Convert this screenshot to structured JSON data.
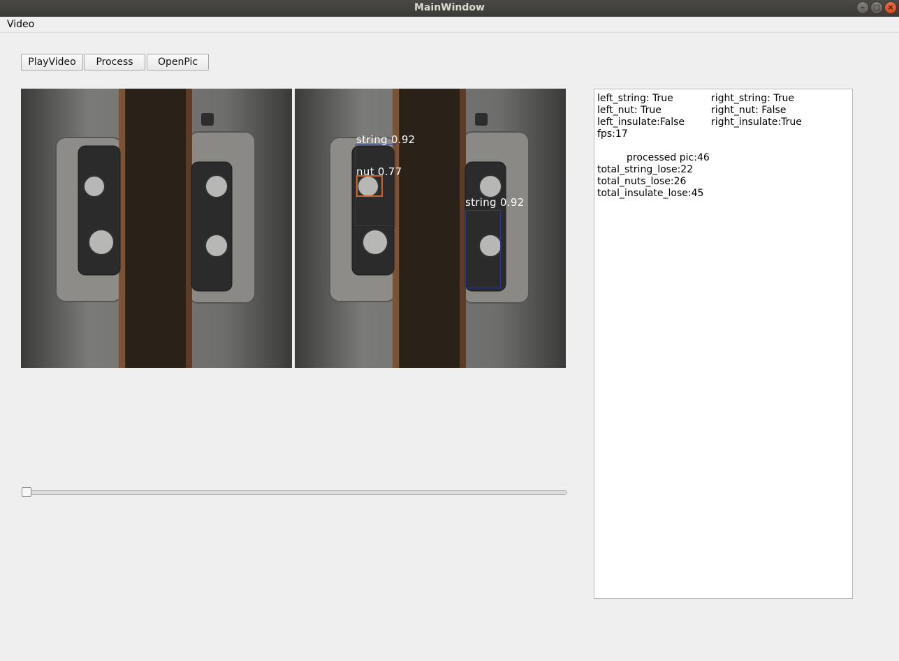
{
  "window": {
    "title": "MainWindow"
  },
  "menubar": {
    "items": [
      "Video"
    ]
  },
  "toolbar": {
    "play_label": "PlayVideo",
    "process_label": "Process",
    "openpic_label": "OpenPic"
  },
  "detections": [
    {
      "label": "string 0.92",
      "color": "#2a3a7c"
    },
    {
      "label": "nut 0.77",
      "color": "#c8632a"
    },
    {
      "label": "string 0.92",
      "color": "#2a3a7c"
    }
  ],
  "slider": {
    "value": 0
  },
  "info": {
    "left_string": "left_string: True",
    "left_nut": "left_nut: True",
    "left_insulate": "left_insulate:False",
    "fps": "fps:17",
    "right_string": "right_string: True",
    "right_nut": "right_nut: False",
    "right_insulate": "right_insulate:True",
    "processed_pic": "processed pic:46",
    "total_string_lose": "total_string_lose:22",
    "total_nuts_lose": "total_nuts_lose:26",
    "total_insulate_lose": "total_insulate_lose:45"
  }
}
